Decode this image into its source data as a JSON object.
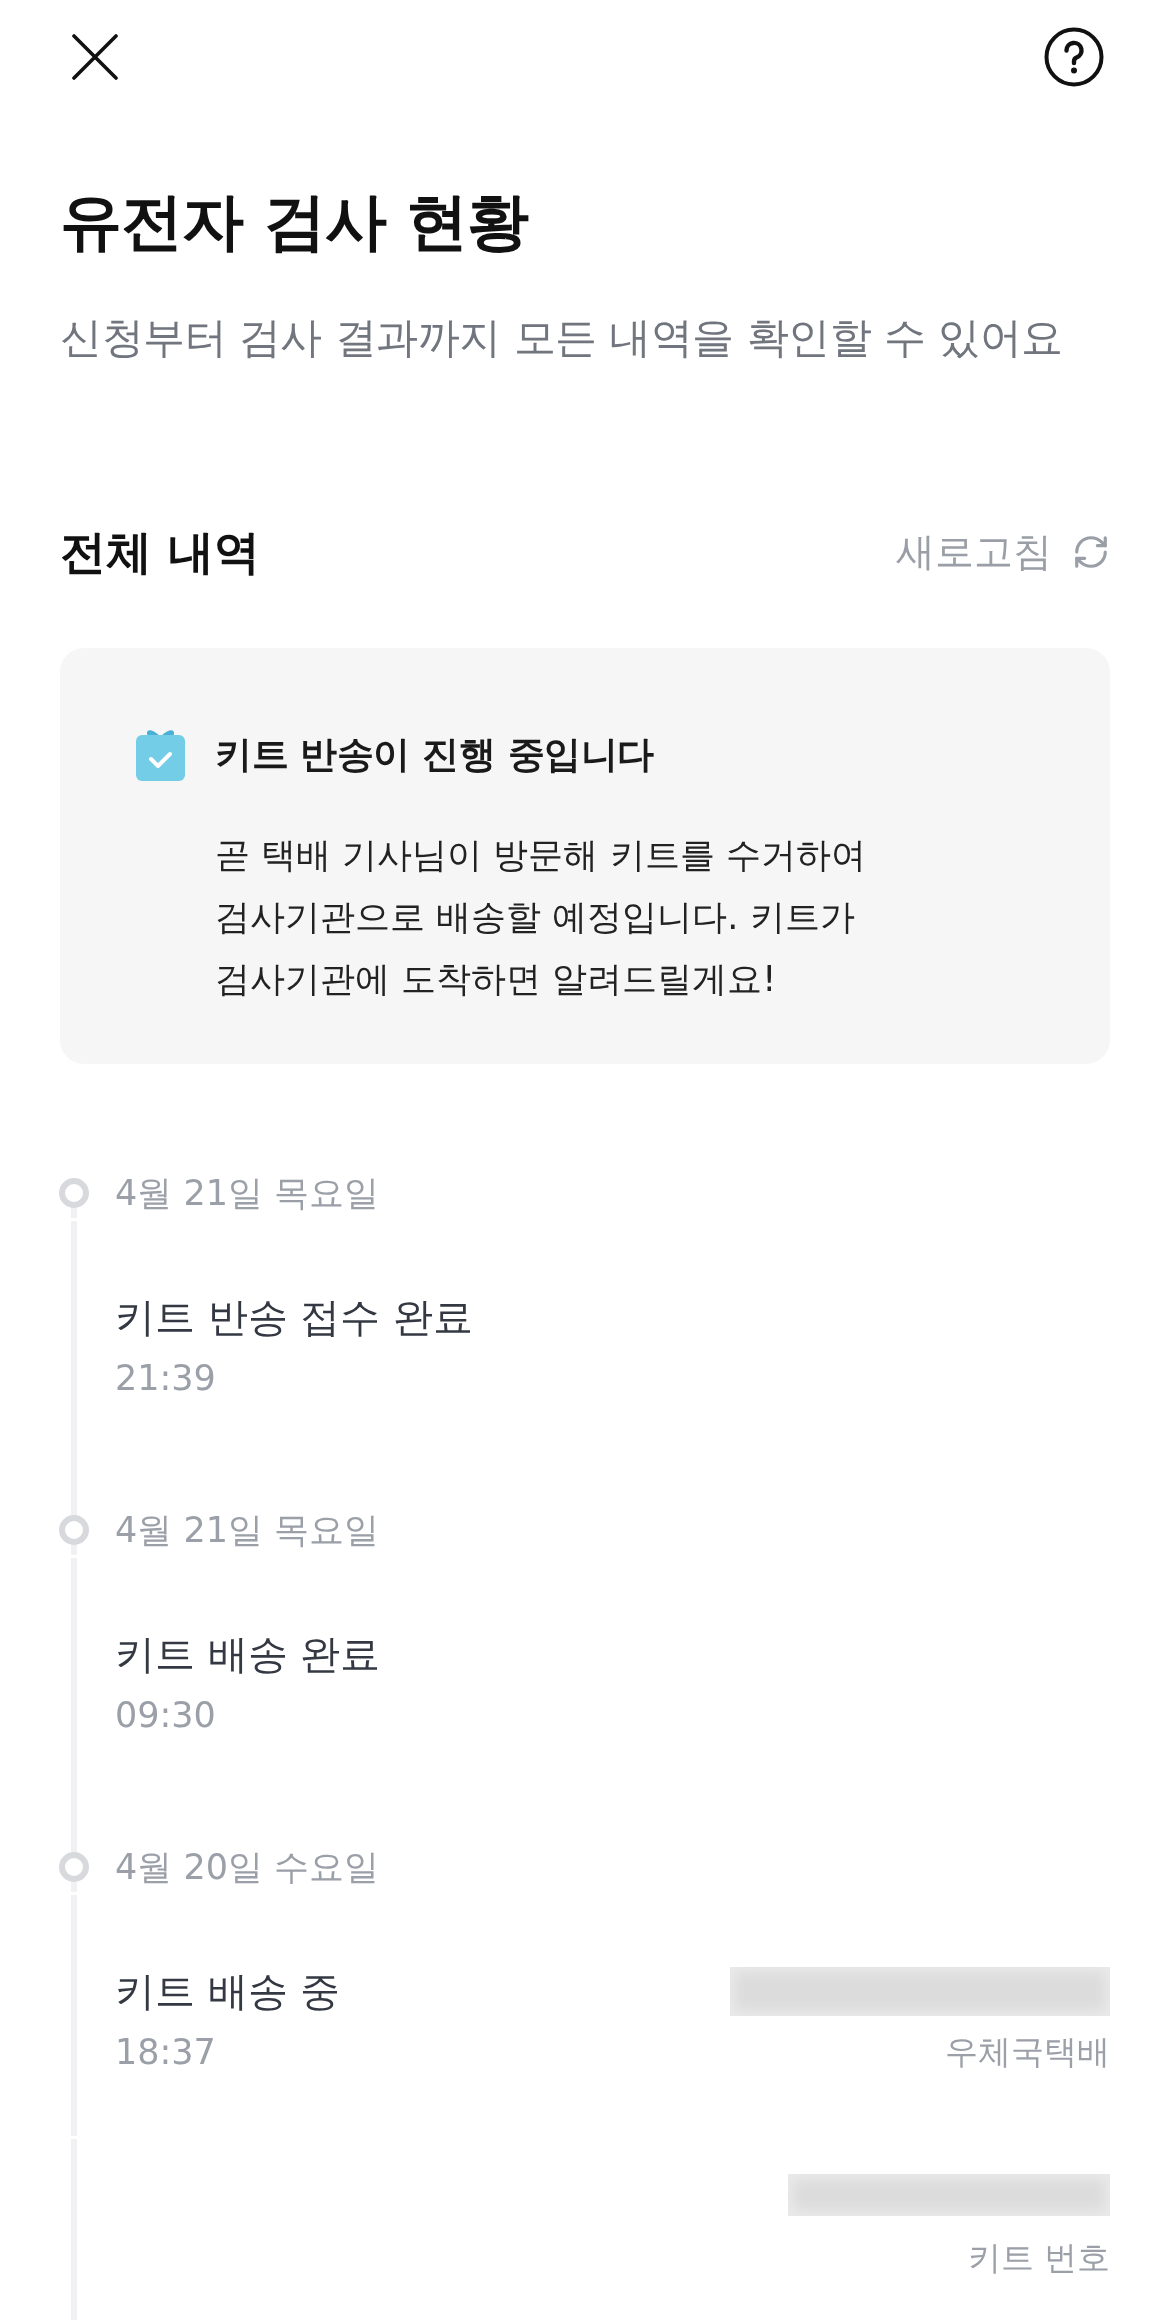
{
  "title": "유전자 검사 현황",
  "subtitle": "신청부터 검사 결과까지 모든 내역을 확인할 수 있어요",
  "section": {
    "title": "전체 내역",
    "refresh_label": "새로고침"
  },
  "notice": {
    "title": "키트 반송이 진행 중입니다",
    "body": "곧 택배 기사님이 방문해 키트를 수거하여 검사기관으로 배송할 예정입니다. 키트가 검사기관에 도착하면 알려드릴게요!"
  },
  "timeline": [
    {
      "date": "4월 21일 목요일",
      "events": [
        {
          "title": "키트 반송 접수 완료",
          "time": "21:39"
        }
      ]
    },
    {
      "date": "4월 21일 목요일",
      "events": [
        {
          "title": "키트 배송 완료",
          "time": "09:30"
        }
      ]
    },
    {
      "date": "4월 20일 수요일",
      "events": [
        {
          "title": "키트 배송 중",
          "time": "18:37",
          "details": [
            {
              "label": "우체국택배",
              "redacted": true
            },
            {
              "label": "키트 번호",
              "redacted": true
            }
          ]
        }
      ]
    }
  ]
}
